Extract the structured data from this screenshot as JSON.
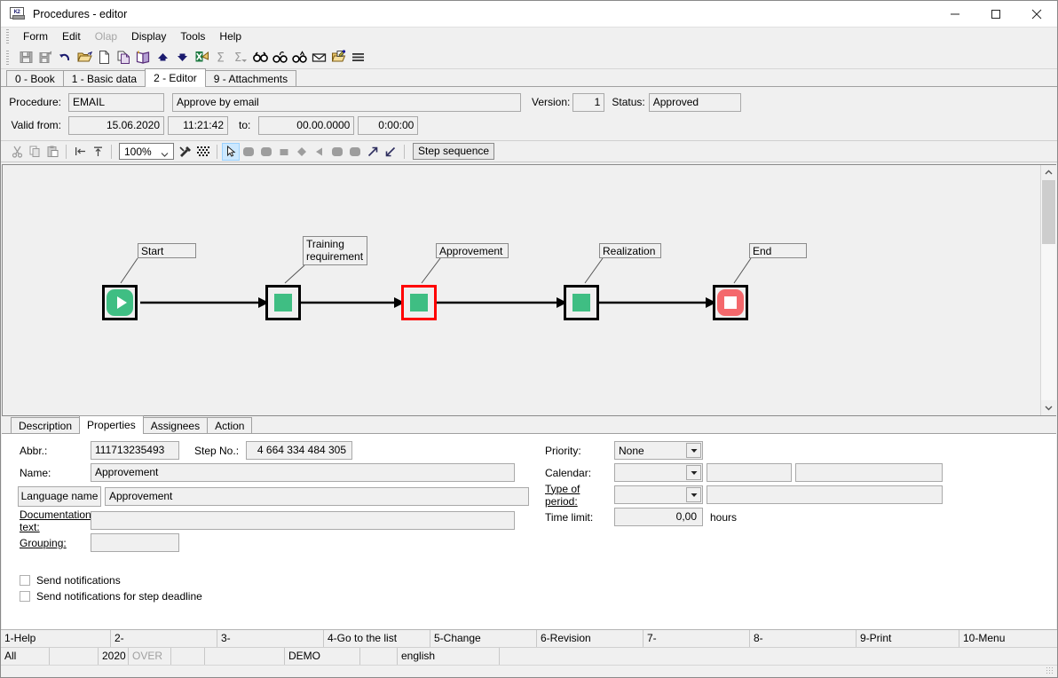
{
  "window": {
    "title": "Procedures - editor",
    "icon": "app-icon",
    "minimize": "minimize-icon",
    "maximize": "maximize-icon",
    "close": "close-icon"
  },
  "menubar": {
    "items": [
      {
        "label": "Form",
        "disabled": false
      },
      {
        "label": "Edit",
        "disabled": false
      },
      {
        "label": "Olap",
        "disabled": true
      },
      {
        "label": "Display",
        "disabled": false
      },
      {
        "label": "Tools",
        "disabled": false
      },
      {
        "label": "Help",
        "disabled": false
      }
    ]
  },
  "toolbar": {
    "buttons": [
      {
        "name": "save-icon"
      },
      {
        "name": "save-as-icon"
      },
      {
        "name": "undo-icon"
      },
      {
        "name": "open-folder-icon"
      },
      {
        "name": "new-document-icon"
      },
      {
        "name": "copy-document-icon"
      },
      {
        "name": "book-icon"
      },
      {
        "name": "arrow-up-icon"
      },
      {
        "name": "arrow-down-icon"
      },
      {
        "name": "export-excel-icon"
      },
      {
        "name": "sum-icon"
      },
      {
        "name": "sum-filter-icon"
      },
      {
        "name": "find-icon"
      },
      {
        "name": "find-next-icon"
      },
      {
        "name": "find-prev-icon"
      },
      {
        "name": "mail-icon"
      },
      {
        "name": "edit-note-icon"
      },
      {
        "name": "menu-lines-icon"
      }
    ]
  },
  "tabs": {
    "items": [
      {
        "label": "0 - Book",
        "active": false
      },
      {
        "label": "1 - Basic data",
        "active": false
      },
      {
        "label": "2 - Editor",
        "active": true
      },
      {
        "label": "9 - Attachments",
        "active": false
      }
    ]
  },
  "header": {
    "procedure_label": "Procedure:",
    "procedure_code": "EMAIL",
    "procedure_name": "Approve by email",
    "version_label": "Version:",
    "version_value": "1",
    "status_label": "Status:",
    "status_value": "Approved",
    "valid_from_label": "Valid from:",
    "valid_from_date": "15.06.2020",
    "valid_from_time": "11:21:42",
    "to_label": "to:",
    "valid_to_date": "00.00.0000",
    "valid_to_time": "0:00:00"
  },
  "editor_toolbar": {
    "cut": "cut-icon",
    "copy": "copy-icon",
    "paste": "paste-icon",
    "align_left": "align-left-icon",
    "align_top": "align-top-icon",
    "zoom_value": "100%",
    "tools_icon": "tools-icon",
    "grid_icon": "grid-icon",
    "pointer_icon": "pointer-icon",
    "shapes": [
      {
        "name": "shape-rounded-rect-icon"
      },
      {
        "name": "shape-rounded-square-icon"
      },
      {
        "name": "shape-square-icon"
      },
      {
        "name": "shape-diamond-icon"
      },
      {
        "name": "shape-triangle-left-icon"
      },
      {
        "name": "shape-rounded-square-2-icon"
      },
      {
        "name": "shape-rounded-square-3-icon"
      },
      {
        "name": "connector-up-right-icon"
      },
      {
        "name": "connector-down-left-icon"
      }
    ],
    "step_sequence_label": "Step sequence"
  },
  "diagram": {
    "nodes": [
      {
        "label": "Start",
        "type": "start",
        "selected": false
      },
      {
        "label": "Training\nrequirement",
        "type": "task",
        "selected": false
      },
      {
        "label": "Approvement",
        "type": "task",
        "selected": true
      },
      {
        "label": "Realization",
        "type": "task",
        "selected": false
      },
      {
        "label": "End",
        "type": "end",
        "selected": false
      }
    ],
    "scroll_up": "scroll-up-icon",
    "scroll_down": "scroll-down-icon"
  },
  "lower_tabs": {
    "items": [
      {
        "label": "Description",
        "active": false
      },
      {
        "label": "Properties",
        "active": true
      },
      {
        "label": "Assignees",
        "active": false
      },
      {
        "label": "Action",
        "active": false
      }
    ]
  },
  "properties": {
    "abbr_label": "Abbr.:",
    "abbr_value": "111713235493",
    "step_no_label": "Step No.:",
    "step_no_value": "4 664 334 484 305",
    "name_label": "Name:",
    "name_value": "Approvement",
    "language_name_button": "Language name",
    "language_name_value": "Approvement",
    "documentation_label": "Documentation text:",
    "documentation_value": "",
    "grouping_label": "Grouping:",
    "grouping_value": "",
    "priority_label": "Priority:",
    "priority_value": "None",
    "calendar_label": "Calendar:",
    "calendar_value": "",
    "calendar_extra1": "",
    "calendar_extra2": "",
    "type_of_period_label": "Type of period:",
    "type_of_period_value": "",
    "type_of_period_extra": "",
    "time_limit_label": "Time limit:",
    "time_limit_value": "0,00",
    "time_limit_unit": "hours",
    "send_notifications_label": "Send notifications",
    "send_notifications_checked": false,
    "send_notifications_deadline_label": "Send notifications for step deadline",
    "send_notifications_deadline_checked": false
  },
  "function_keys": [
    {
      "label": "1-Help"
    },
    {
      "label": "2-"
    },
    {
      "label": "3-"
    },
    {
      "label": "4-Go to the list"
    },
    {
      "label": "5-Change"
    },
    {
      "label": "6-Revision"
    },
    {
      "label": "7-"
    },
    {
      "label": "8-"
    },
    {
      "label": "9-Print"
    },
    {
      "label": "10-Menu"
    }
  ],
  "status_bar": [
    {
      "label": "All",
      "gray": false
    },
    {
      "label": "",
      "gray": false
    },
    {
      "label": "2020",
      "gray": false
    },
    {
      "label": "OVER",
      "gray": true
    },
    {
      "label": "",
      "gray": false
    },
    {
      "label": "",
      "gray": false
    },
    {
      "label": "DEMO",
      "gray": false
    },
    {
      "label": "",
      "gray": false
    },
    {
      "label": "english",
      "gray": false
    },
    {
      "label": "",
      "gray": false
    }
  ],
  "colors": {
    "node_green": "#3fbe83",
    "node_red": "#f4686c",
    "selection_red": "#ff0000",
    "window_bg": "#f0f0f0",
    "selected_tool_bg": "#cce8ff"
  }
}
